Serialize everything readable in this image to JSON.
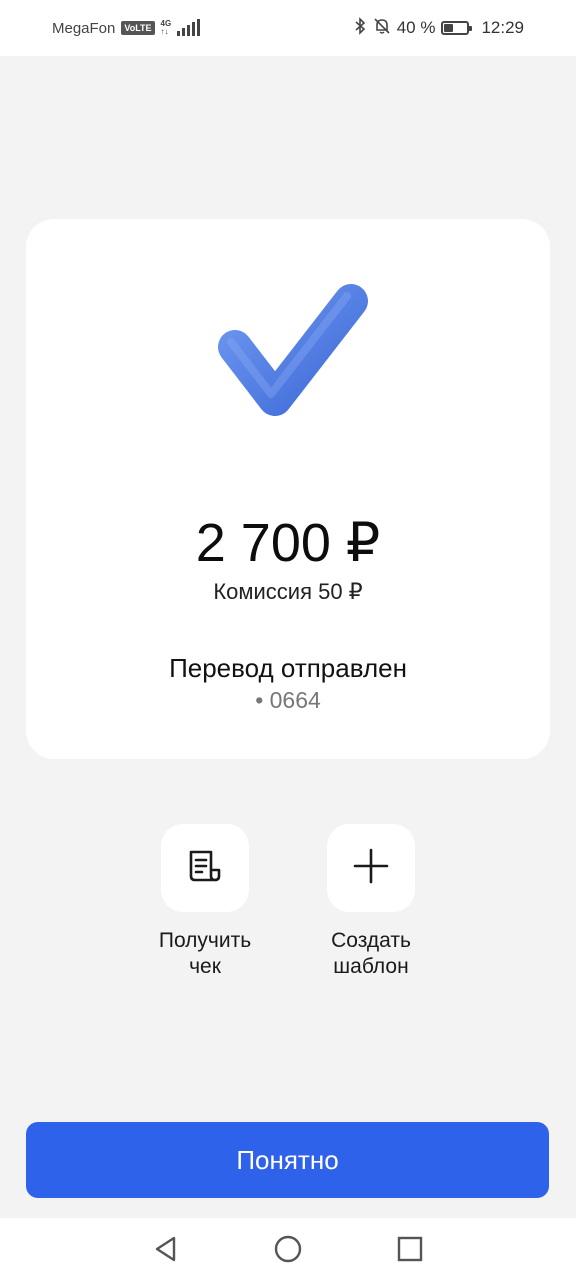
{
  "status_bar": {
    "carrier": "MegaFon",
    "volte": "VoLTE",
    "network": "4G",
    "battery_percent": "40 %",
    "battery_level": 0.4,
    "time": "12:29"
  },
  "result": {
    "amount": "2 700 ₽",
    "fee": "Комиссия 50 ₽",
    "title": "Перевод отправлен",
    "card": "• 0664",
    "accent_color": "#4f7fe0"
  },
  "actions": [
    {
      "label": "Получить\nчек",
      "icon": "receipt-icon"
    },
    {
      "label": "Создать\nшаблон",
      "icon": "plus-icon"
    }
  ],
  "primary_button": {
    "label": "Понятно",
    "color": "#2f62ea"
  },
  "nav": [
    "back-icon",
    "home-icon",
    "recents-icon"
  ]
}
